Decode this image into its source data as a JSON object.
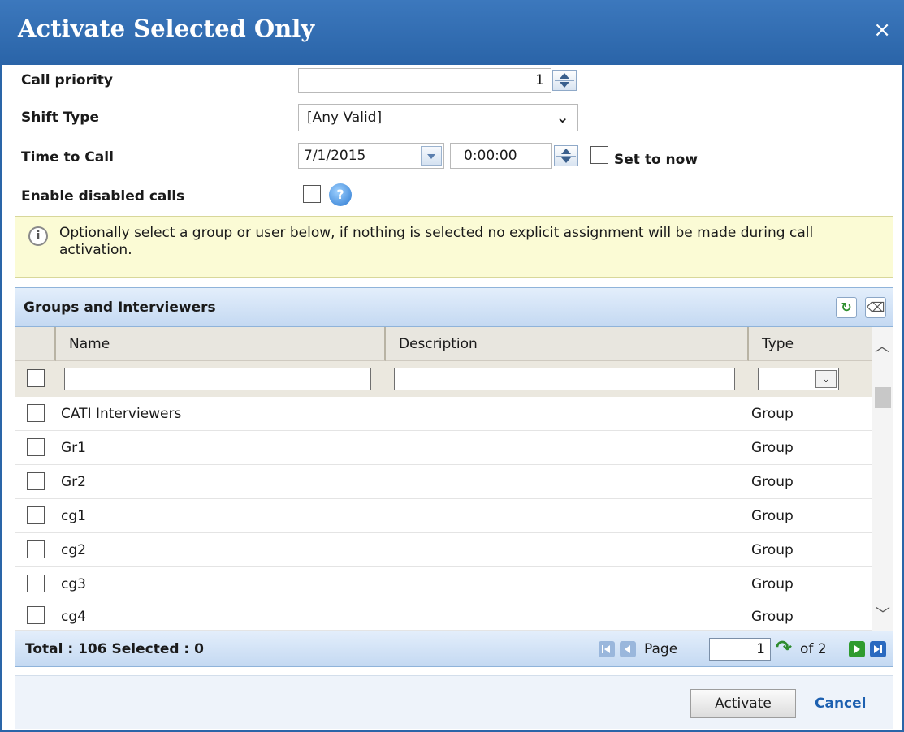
{
  "dialog": {
    "title": "Activate Selected Only",
    "close_glyph": "×"
  },
  "form": {
    "call_priority": {
      "label": "Call priority",
      "value": "1"
    },
    "shift_type": {
      "label": "Shift Type",
      "value": "[Any Valid]"
    },
    "time_to_call": {
      "label": "Time to Call",
      "date": "7/1/2015",
      "time": "0:00:00",
      "set_to_now_label": "Set to now"
    },
    "enable_disabled_calls": {
      "label": "Enable disabled calls",
      "help_glyph": "?"
    }
  },
  "info": {
    "icon_glyph": "i",
    "text": "Optionally select a group or user below, if nothing is selected no explicit assignment will be made during call activation."
  },
  "grid": {
    "title": "Groups and Interviewers",
    "columns": {
      "name": "Name",
      "description": "Description",
      "type": "Type"
    },
    "rows": [
      {
        "name": "CATI Interviewers",
        "description": "",
        "type": "Group"
      },
      {
        "name": "Gr1",
        "description": "",
        "type": "Group"
      },
      {
        "name": "Gr2",
        "description": "",
        "type": "Group"
      },
      {
        "name": "cg1",
        "description": "",
        "type": "Group"
      },
      {
        "name": "cg2",
        "description": "",
        "type": "Group"
      },
      {
        "name": "cg3",
        "description": "",
        "type": "Group"
      },
      {
        "name": "cg4",
        "description": "",
        "type": "Group"
      }
    ],
    "footer": {
      "totals": "Total : 106 Selected : 0",
      "page_label": "Page",
      "page_value": "1",
      "of_label": "of 2"
    }
  },
  "actions": {
    "activate": "Activate",
    "cancel": "Cancel"
  },
  "colors": {
    "title_bar": "#2f6db3",
    "accent_link": "#1d60b0",
    "info_bg": "#fbfbd5"
  }
}
